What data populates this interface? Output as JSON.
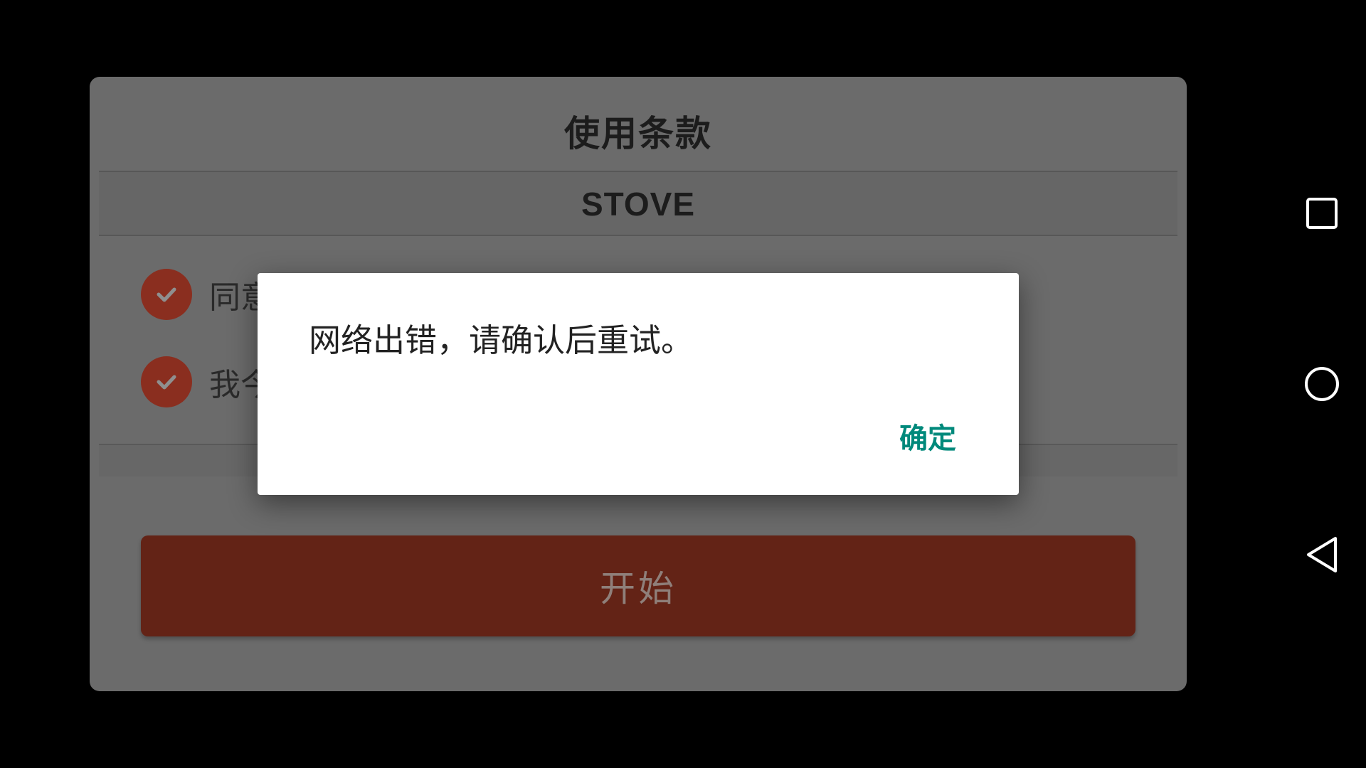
{
  "terms_panel": {
    "title": "使用条款",
    "provider": "STOVE",
    "options": [
      {
        "label": "同意",
        "checked": true
      },
      {
        "label": "我今",
        "checked": true
      }
    ],
    "start_label": "开始"
  },
  "dialog": {
    "message": "网络出错，请确认后重试。",
    "ok_label": "确定"
  },
  "navbar": {
    "icons": [
      "recent-apps-icon",
      "home-icon",
      "back-icon"
    ]
  },
  "colors": {
    "accent": "#00897b",
    "check": "#c8452c",
    "start_button": "#c8452c"
  }
}
